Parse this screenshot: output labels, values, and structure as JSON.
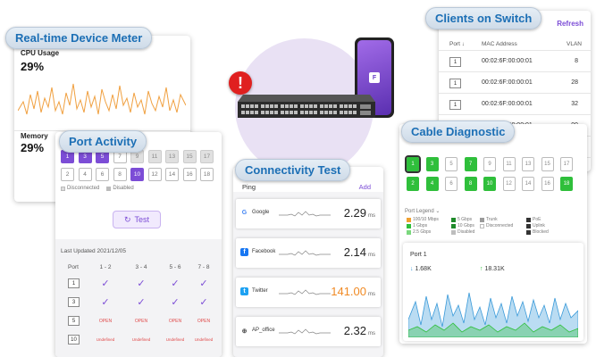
{
  "meter": {
    "title": "Real-time Device Meter",
    "cpu_label": "CPU Usage",
    "cpu_value": "29%",
    "memory_label": "Memory",
    "memory_value": "29%"
  },
  "activity": {
    "title": "Port Activity",
    "ports_top": [
      "1",
      "3",
      "5",
      "7",
      "9",
      "11",
      "13",
      "15",
      "17"
    ],
    "ports_bottom": [
      "2",
      "4",
      "6",
      "8",
      "10",
      "12",
      "14",
      "16",
      "18"
    ],
    "legend_disconnected": "Disconnected",
    "legend_disabled": "Disabled",
    "test_label": "Test",
    "last_updated": "Last Updated 2021/12/05",
    "columns": [
      "Port",
      "1 - 2",
      "3 - 4",
      "5 - 6",
      "7 - 8"
    ],
    "rows": [
      {
        "port": "1",
        "cells": [
          "check",
          "check",
          "check",
          "check"
        ]
      },
      {
        "port": "3",
        "cells": [
          "check",
          "check",
          "check",
          "check"
        ]
      },
      {
        "port": "5",
        "cells": [
          "OPEN",
          "OPEN",
          "OPEN",
          "OPEN"
        ]
      },
      {
        "port": "10",
        "cells": [
          "Undefined",
          "Undefined",
          "Undefined",
          "Undefined"
        ]
      }
    ]
  },
  "connectivity": {
    "title": "Connectivity Test",
    "ping_label": "Ping",
    "add_label": "Add",
    "unit": "ms",
    "rows": [
      {
        "name": "Google",
        "value": "2.29",
        "icon": "google-icon",
        "color": "#222222"
      },
      {
        "name": "Facebook",
        "value": "2.14",
        "icon": "facebook-icon",
        "color": "#222222"
      },
      {
        "name": "Twitter",
        "value": "141.00",
        "icon": "twitter-icon",
        "color": "#f08a24"
      },
      {
        "name": "AP_office",
        "value": "2.32",
        "icon": "globe-icon",
        "color": "#222222"
      }
    ]
  },
  "clients": {
    "title": "Clients on Switch",
    "refresh_label": "Refresh",
    "col_port": "Port",
    "col_mac": "MAC Address",
    "col_vlan": "VLAN",
    "rows": [
      {
        "port": "1",
        "mac": "00:02:6F:00:00:01",
        "vlan": "8"
      },
      {
        "port": "1",
        "mac": "00:02:6F:00:00:01",
        "vlan": "28"
      },
      {
        "port": "1",
        "mac": "00:02:6F:00:00:01",
        "vlan": "32"
      },
      {
        "port": "1",
        "mac": "00:02:6F:00:00:01",
        "vlan": "99"
      },
      {
        "port": "",
        "mac": "",
        "vlan": "13"
      },
      {
        "port": "",
        "mac": "",
        "vlan": "26"
      }
    ]
  },
  "cable": {
    "title": "Cable Diagnostic",
    "ports_top": [
      "1",
      "3",
      "5",
      "7",
      "9",
      "11",
      "13",
      "15",
      "17"
    ],
    "ports_bottom": [
      "2",
      "4",
      "6",
      "8",
      "10",
      "12",
      "14",
      "16",
      "18"
    ],
    "green_top": [
      "1",
      "3",
      "7"
    ],
    "green_bottom": [
      "2",
      "4",
      "8",
      "10",
      "18"
    ],
    "legend_title": "Port Legend",
    "legend": [
      {
        "label": "100/10 Mbps",
        "color": "#f0a030"
      },
      {
        "label": "5 Gbps",
        "color": "#1f8a2a"
      },
      {
        "label": "Trunk",
        "color": "#9a9a9a"
      },
      {
        "label": "PoE",
        "color": "#333333"
      },
      {
        "label": "1 Gbps",
        "color": "#2fbf3b"
      },
      {
        "label": "10 Gbps",
        "color": "#1f8a2a"
      },
      {
        "label": "Disconnected",
        "color": "#ffffff"
      },
      {
        "label": "Uplink",
        "color": "#333333"
      },
      {
        "label": "2.5 Gbps",
        "color": "#7bd87e"
      },
      {
        "label": "Disabled",
        "color": "#bdbdbd"
      },
      {
        "label": "",
        "color": "#ffffff"
      },
      {
        "label": "Blocked",
        "color": "#333333"
      }
    ],
    "port1_title": "Port 1",
    "down_value": "1.68K",
    "up_value": "18.31K"
  },
  "colors": {
    "purple": "#7c4dd6",
    "green": "#2fbf3b",
    "brand_blue": "#1c6fb5",
    "alert_red": "#e02020"
  }
}
